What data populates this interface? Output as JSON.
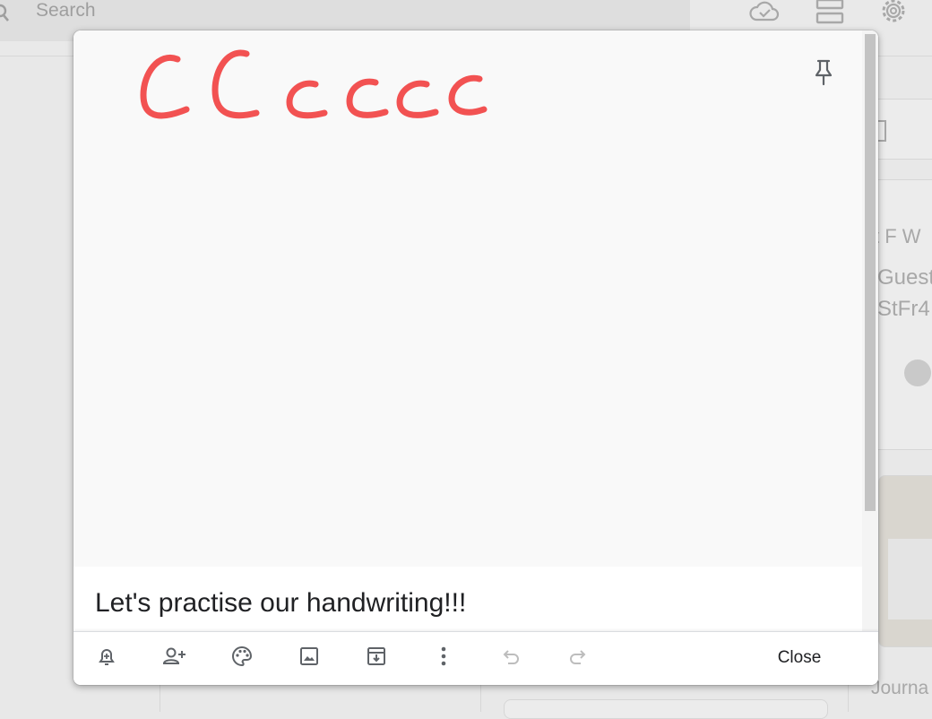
{
  "background": {
    "search_placeholder": "Search",
    "partial_texts": {
      "card_title": "t F W",
      "card_line1": "Guest",
      "card_line2": "StFr4",
      "bottom_label": "Journa"
    },
    "icons": [
      "search-icon",
      "cloud-check-icon",
      "list-view-icon",
      "settings-gear-icon"
    ]
  },
  "note": {
    "title": "Let's practise our handwriting!!!",
    "drawing": {
      "content": "CCcccc",
      "ink_color": "#f25252"
    },
    "pinned": false
  },
  "toolbar": {
    "close_label": "Close",
    "buttons": [
      {
        "icon": "remind-me-icon"
      },
      {
        "icon": "collaborator-icon"
      },
      {
        "icon": "palette-icon"
      },
      {
        "icon": "add-image-icon"
      },
      {
        "icon": "archive-icon"
      },
      {
        "icon": "more-vert-icon"
      },
      {
        "icon": "undo-icon",
        "disabled": true
      },
      {
        "icon": "redo-icon",
        "disabled": true
      }
    ]
  },
  "colors": {
    "ink": "#f25252",
    "icon": "#5f6368",
    "disabled_icon": "#bdbdbd"
  }
}
